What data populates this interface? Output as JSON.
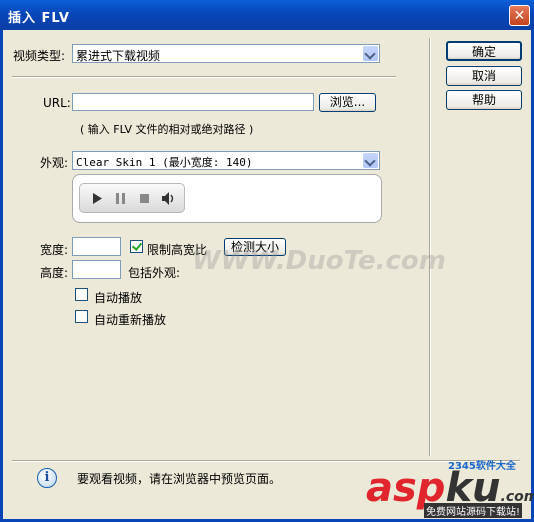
{
  "window": {
    "title": "插入 FLV",
    "close_glyph": "✕"
  },
  "video_type": {
    "label": "视频类型:",
    "value": "累进式下载视频"
  },
  "buttons": {
    "ok": "确定",
    "cancel": "取消",
    "help": "帮助"
  },
  "url": {
    "label": "URL:",
    "value": "",
    "browse": "浏览...",
    "hint": "( 输入 FLV 文件的相对或绝对路径 )"
  },
  "skin": {
    "label": "外观:",
    "value": "Clear Skin 1 (最小宽度: 140)"
  },
  "dimensions": {
    "width_label": "宽度:",
    "width_value": "",
    "height_label": "高度:",
    "height_value": "",
    "constrain_label": "限制高宽比",
    "constrain_checked": true,
    "detect_size": "检测大小",
    "includes_skin": "包括外观:"
  },
  "options": {
    "autoplay": "自动播放",
    "autorewind": "自动重新播放"
  },
  "footer": {
    "info_glyph": "i",
    "message": "要观看视频，请在浏览器中预览页面。"
  },
  "watermark": {
    "text": "WWW.DuoTe.com"
  },
  "branding": {
    "aspku_a": "asp",
    "aspku_b": "ku",
    "aspku_suffix": ".com",
    "small": "2345软件大全",
    "tag": "免费网站源码下载站!"
  }
}
